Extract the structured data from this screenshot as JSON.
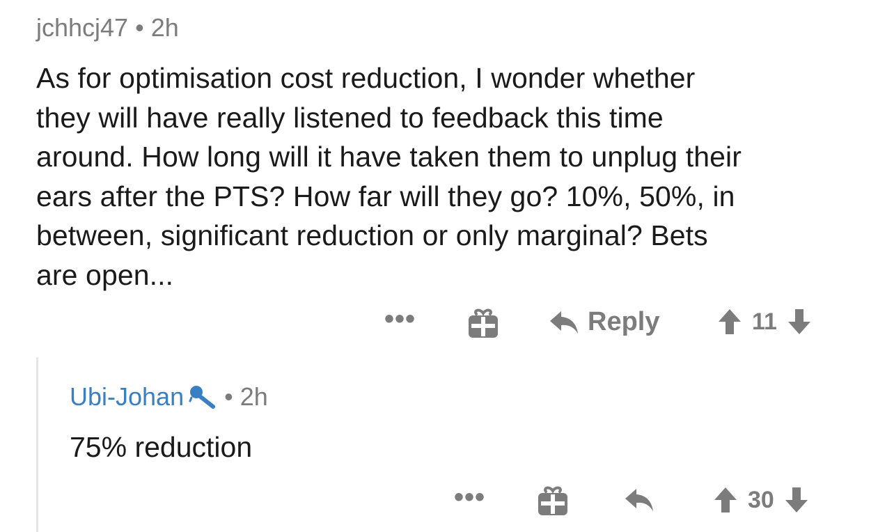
{
  "comment": {
    "author": "jchhcj47",
    "separator": "•",
    "age": "2h",
    "body": "As for optimisation cost reduction, I wonder whether\nthey will have really listened to feedback this time\naround. How long will it have taken them to unplug their\nears after the PTS? How far will they go? 10%, 50%, in\nbetween, significant reduction or only marginal? Bets\nare open...",
    "actions": {
      "more_label": "•••",
      "gift_icon": "gift-icon",
      "reply_icon": "reply-arrow-icon",
      "reply_label": "Reply",
      "upvote_icon": "upvote-arrow-icon",
      "score": "11",
      "downvote_icon": "downvote-arrow-icon"
    }
  },
  "reply": {
    "author": "Ubi-Johan",
    "author_badge_icon": "admin-microphone-icon",
    "separator": "•",
    "age": "2h",
    "body": "75% reduction",
    "actions": {
      "more_label": "•••",
      "gift_icon": "gift-icon",
      "reply_icon": "reply-arrow-icon",
      "upvote_icon": "upvote-arrow-icon",
      "score": "30",
      "downvote_icon": "downvote-arrow-icon"
    }
  },
  "colors": {
    "meta_gray": "#7c7c7c",
    "body_text": "#1a1a1b",
    "author_link": "#3a7fc4",
    "thread_line": "#e5e5e5"
  }
}
